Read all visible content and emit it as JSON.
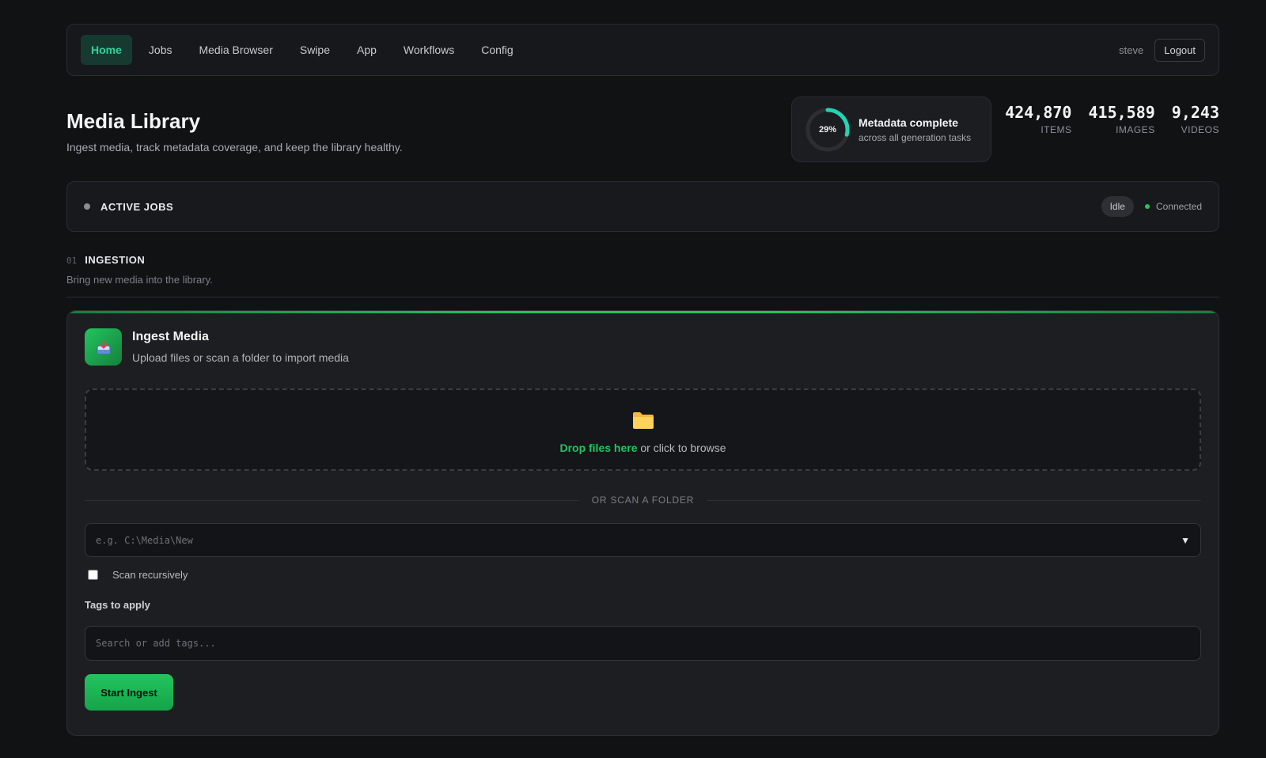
{
  "nav": {
    "items": [
      {
        "label": "Home",
        "active": true
      },
      {
        "label": "Jobs"
      },
      {
        "label": "Media Browser"
      },
      {
        "label": "Swipe"
      },
      {
        "label": "App"
      },
      {
        "label": "Workflows"
      },
      {
        "label": "Config"
      }
    ],
    "username": "steve",
    "logout_label": "Logout"
  },
  "header": {
    "title": "Media Library",
    "subtitle": "Ingest media, track metadata coverage, and keep the library healthy.",
    "metadata": {
      "percent_label": "29%",
      "percent_value": 0.29,
      "title": "Metadata complete",
      "subtitle": "across all generation tasks",
      "ring_color": "#22d3b4"
    },
    "stats": [
      {
        "value": "424,870",
        "label": "ITEMS"
      },
      {
        "value": "415,589",
        "label": "IMAGES"
      },
      {
        "value": "9,243",
        "label": "VIDEOS"
      }
    ]
  },
  "active_jobs": {
    "title": "ACTIVE JOBS",
    "status_badge": "Idle",
    "connection": "Connected",
    "connection_color": "#22c55e"
  },
  "section": {
    "number": "01",
    "title": "INGESTION",
    "subtitle": "Bring new media into the library."
  },
  "ingest": {
    "title": "Ingest Media",
    "subtitle": "Upload files or scan a folder to import media",
    "icon": "inbox-tray-icon",
    "dropzone": {
      "icon": "folder-icon",
      "strong": "Drop files here",
      "rest": " or click to browse"
    },
    "or_divider": "OR SCAN A FOLDER",
    "folder_placeholder": "e.g. C:\\Media\\New",
    "recursive_label": "Scan recursively",
    "recursive_checked": false,
    "tags_label": "Tags to apply",
    "tags_placeholder": "Search or add tags...",
    "start_button": "Start Ingest",
    "accent_color": "#22c55e"
  }
}
